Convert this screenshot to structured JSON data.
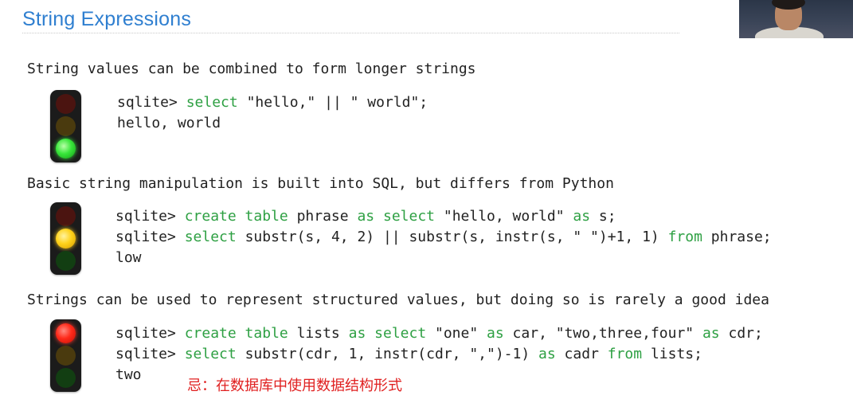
{
  "slide": {
    "title": "String Expressions"
  },
  "sections": [
    {
      "intro": "String values can be combined to form longer strings",
      "light": "green",
      "lines": [
        [
          {
            "t": "sqlite> "
          },
          {
            "t": "select",
            "kw": true
          },
          {
            "t": " \"hello,\" || \" world\";"
          }
        ],
        [
          {
            "t": "hello, world"
          }
        ]
      ]
    },
    {
      "intro": "Basic string manipulation is built into SQL, but differs from Python",
      "light": "yellow",
      "lines": [
        [
          {
            "t": "sqlite> "
          },
          {
            "t": "create table",
            "kw": true
          },
          {
            "t": " phrase "
          },
          {
            "t": "as",
            "kw": true
          },
          {
            "t": " "
          },
          {
            "t": "select",
            "kw": true
          },
          {
            "t": " \"hello, world\" "
          },
          {
            "t": "as",
            "kw": true
          },
          {
            "t": " s;"
          }
        ],
        [
          {
            "t": "sqlite> "
          },
          {
            "t": "select",
            "kw": true
          },
          {
            "t": " substr(s, 4, 2) || substr(s, instr(s, \" \")+1, 1) "
          },
          {
            "t": "from",
            "kw": true
          },
          {
            "t": " phrase;"
          }
        ],
        [
          {
            "t": "low"
          }
        ]
      ]
    },
    {
      "intro": "Strings can be used to represent structured values, but doing so is rarely a good idea",
      "light": "red",
      "lines": [
        [
          {
            "t": "sqlite> "
          },
          {
            "t": "create table",
            "kw": true
          },
          {
            "t": " lists "
          },
          {
            "t": "as",
            "kw": true
          },
          {
            "t": " "
          },
          {
            "t": "select",
            "kw": true
          },
          {
            "t": " \"one\" "
          },
          {
            "t": "as",
            "kw": true
          },
          {
            "t": " car, \"two,three,four\" "
          },
          {
            "t": "as",
            "kw": true
          },
          {
            "t": " cdr;"
          }
        ],
        [
          {
            "t": "sqlite> "
          },
          {
            "t": "select",
            "kw": true
          },
          {
            "t": " substr(cdr, 1, instr(cdr, \",\")-1) "
          },
          {
            "t": "as",
            "kw": true
          },
          {
            "t": " cadr "
          },
          {
            "t": "from",
            "kw": true
          },
          {
            "t": " lists;"
          }
        ],
        [
          {
            "t": "two"
          }
        ]
      ]
    }
  ],
  "annotation": "忌：在数据库中使用数据结构形式",
  "colors": {
    "title": "#2f7fd0",
    "keyword": "#2ea043",
    "annotation": "#e02020"
  }
}
